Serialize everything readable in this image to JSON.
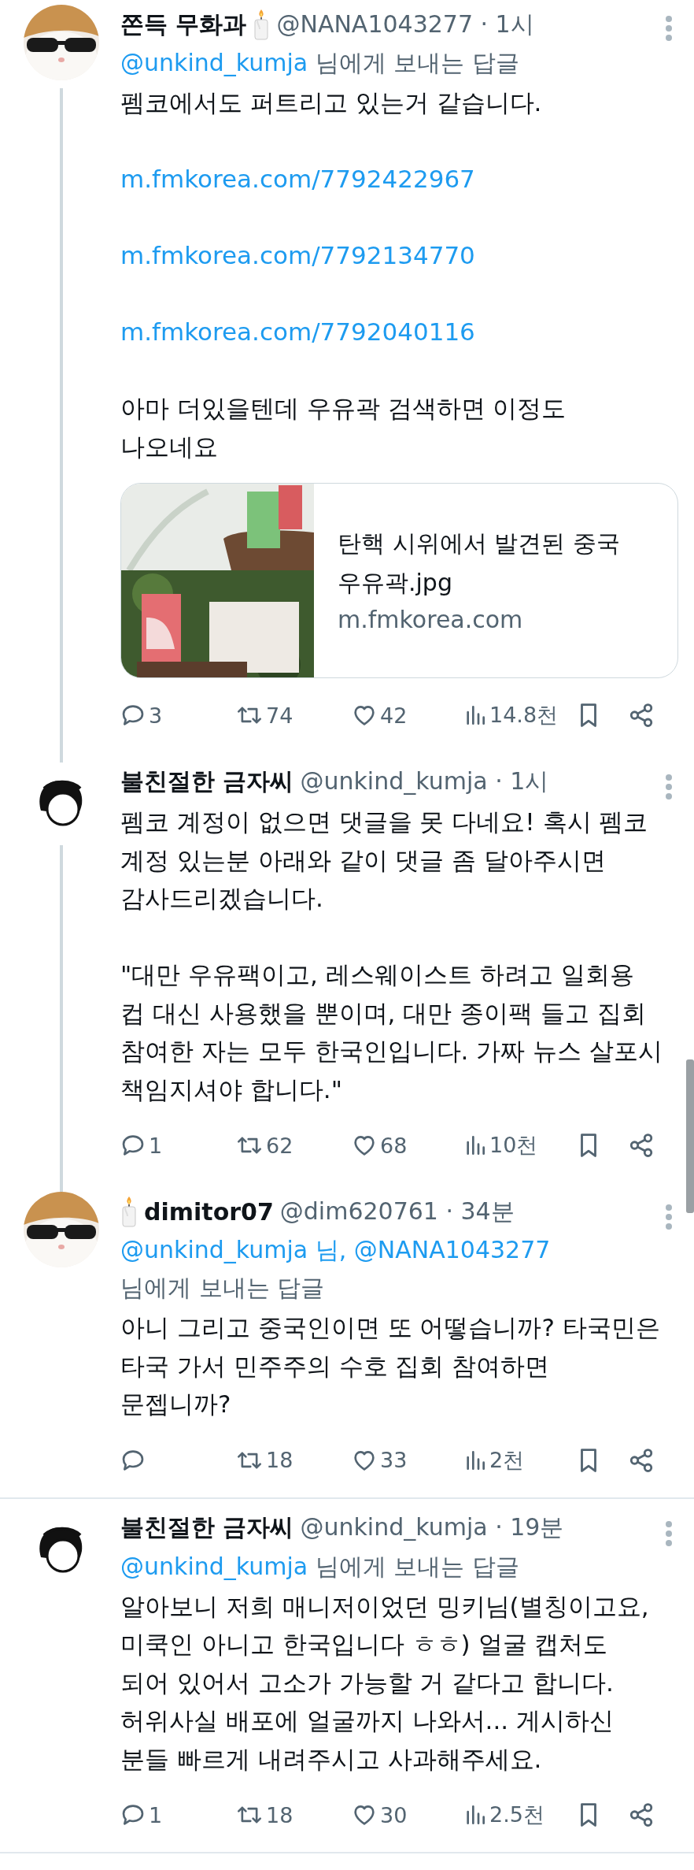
{
  "tweets": [
    {
      "header": [
        {
          "kind": "name",
          "text": "쫀득 무화과"
        },
        {
          "kind": "candle"
        }
      ],
      "meta": "@NANA1043277 · 1시",
      "avatar": {
        "kind": "picture"
      },
      "reply_to": {
        "mentions": "@unkind_kumja",
        "suffix": "님에게 보내는 답글"
      },
      "body": [
        {
          "kind": "text",
          "text": "펨코에서도 퍼트리고 있는거 같습니다."
        },
        {
          "kind": "link",
          "text": "m.fmkorea.com/7792422967"
        },
        {
          "kind": "link",
          "text": "m.fmkorea.com/7792134770"
        },
        {
          "kind": "link",
          "text": "m.fmkorea.com/7792040116"
        },
        {
          "kind": "text",
          "text": "아마 더있을텐데 우유곽 검색하면 이정도\n나오네요"
        }
      ],
      "card": {
        "title": "탄핵 시위에서 발견된 중국\n우유곽.jpg",
        "domain": "m.fmkorea.com"
      },
      "actions": {
        "replies": "3",
        "reposts": "74",
        "likes": "42",
        "views": "14.8천"
      },
      "thread_continues": true
    },
    {
      "header": [
        {
          "kind": "name",
          "text": "불친절한 금자씨"
        }
      ],
      "meta": "@unkind_kumja · 1시",
      "avatar": {
        "kind": "silhouette"
      },
      "body": [
        {
          "kind": "text",
          "text": "펨코 계정이 없으면 댓글을 못 다네요! 혹시 펨코\n계정 있는분 아래와 같이 댓글 좀 달아주시면\n감사드리겠습니다."
        },
        {
          "kind": "text",
          "text": "\"대만 우유팩이고, 레스웨이스트 하려고 일회용\n컵 대신 사용했을 뿐이며, 대만 종이팩 들고 집회\n참여한 자는 모두 한국인입니다. 가짜 뉴스 살포시\n책임지셔야 합니다.\""
        }
      ],
      "actions": {
        "replies": "1",
        "reposts": "62",
        "likes": "68",
        "views": "10천"
      },
      "thread_continues": true
    },
    {
      "header": [
        {
          "kind": "candle"
        },
        {
          "kind": "name",
          "text": "dimitor07"
        }
      ],
      "meta": "@dim620761 · 34분",
      "avatar": {
        "kind": "picture"
      },
      "reply_to": {
        "mentions": "@unkind_kumja 님, @NANA1043277",
        "suffix": "님에게 보내는 답글"
      },
      "body": [
        {
          "kind": "text",
          "text": "아니 그리고 중국인이면 또 어떻습니까? 타국민은\n타국 가서 민주주의 수호 집회 참여하면\n문젭니까?"
        }
      ],
      "actions": {
        "reposts": "18",
        "likes": "33",
        "views": "2천"
      },
      "thread_continues": false
    },
    {
      "header": [
        {
          "kind": "name",
          "text": "불친절한 금자씨"
        }
      ],
      "meta": "@unkind_kumja · 19분",
      "avatar": {
        "kind": "silhouette"
      },
      "reply_to": {
        "mentions": "@unkind_kumja",
        "suffix": "님에게 보내는 답글"
      },
      "body": [
        {
          "kind": "text",
          "text": "알아보니 저희 매니저이었던 밍키님(별칭이고요,\n미쿡인 아니고 한국입니다 ㅎㅎ)  얼굴 캡처도\n되어 있어서 고소가 가능할 거 같다고 합니다.\n허위사실 배포에 얼굴까지 나와서... 게시하신\n분들 빠르게 내려주시고 사과해주세요."
        }
      ],
      "actions": {
        "replies": "1",
        "reposts": "18",
        "likes": "30",
        "views": "2.5천"
      },
      "thread_continues": false
    }
  ]
}
